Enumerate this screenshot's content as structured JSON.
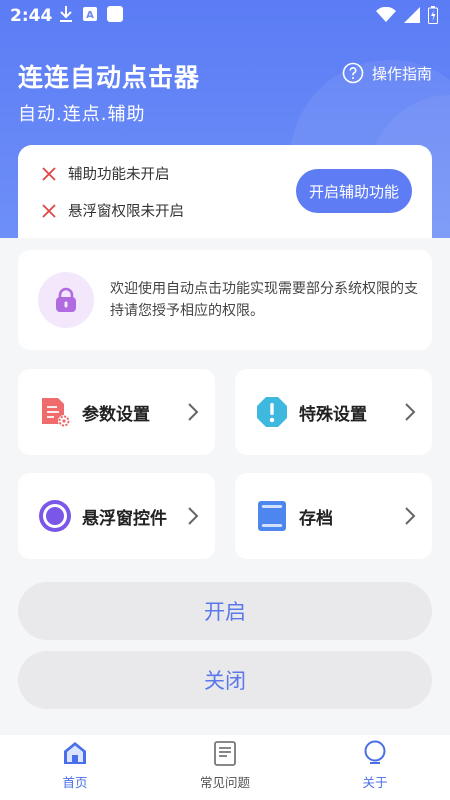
{
  "status_bar": {
    "time": "2:44"
  },
  "header": {
    "title": "连连自动点击器",
    "subtitle": "自动.连点.辅助",
    "guide_label": "操作指南"
  },
  "permissions": {
    "items": [
      {
        "label": "辅助功能未开启"
      },
      {
        "label": "悬浮窗权限未开启"
      }
    ],
    "enable_button": "开启辅助功能"
  },
  "notice": {
    "text": "欢迎使用自动点击功能实现需要部分系统权限的支持请您授予相应的权限。"
  },
  "tiles": [
    {
      "label": "参数设置",
      "icon": "settings-doc-icon"
    },
    {
      "label": "特殊设置",
      "icon": "warning-octagon-icon"
    },
    {
      "label": "悬浮窗控件",
      "icon": "floating-ring-icon"
    },
    {
      "label": "存档",
      "icon": "archive-icon"
    }
  ],
  "actions": {
    "open": "开启",
    "close": "关闭"
  },
  "tabbar": [
    {
      "label": "首页",
      "icon": "home-icon"
    },
    {
      "label": "常见问题",
      "icon": "faq-icon"
    },
    {
      "label": "关于",
      "icon": "about-icon"
    }
  ],
  "colors": {
    "primary": "#5e7cf3",
    "header": "#6a89f6",
    "error": "#e04545"
  }
}
